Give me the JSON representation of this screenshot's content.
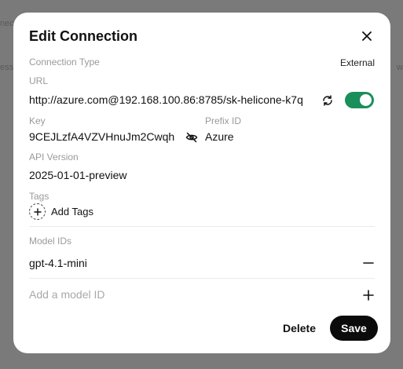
{
  "backdrop": {
    "frag_top": "nec",
    "frag_left": "ess",
    "frag_right": "w"
  },
  "dialog": {
    "title": "Edit Connection",
    "connection_type": {
      "label": "Connection Type",
      "value": "External"
    },
    "url": {
      "label": "URL",
      "value": "http://azure.com@192.168.100.86:8785/sk-helicone-k7q",
      "enabled": true
    },
    "key": {
      "label": "Key",
      "value": "9CEJLzfA4VZVHnuJm2Cwqh"
    },
    "prefix_id": {
      "label": "Prefix ID",
      "value": "Azure"
    },
    "api_version": {
      "label": "API Version",
      "value": "2025-01-01-preview"
    },
    "tags": {
      "label": "Tags",
      "add_label": "Add Tags"
    },
    "model_ids": {
      "label": "Model IDs",
      "items": [
        "gpt-4.1-mini"
      ],
      "input_placeholder": "Add a model ID",
      "input_value": ""
    },
    "buttons": {
      "delete": "Delete",
      "save": "Save"
    }
  },
  "colors": {
    "toggle_on": "#1a8f5a",
    "save_bg": "#0b0b0b",
    "overlay": "#7a7a7a"
  },
  "icons": [
    "close-icon",
    "refresh-icon",
    "eye-off-icon",
    "plus-circle-icon",
    "minus-icon",
    "plus-icon"
  ]
}
